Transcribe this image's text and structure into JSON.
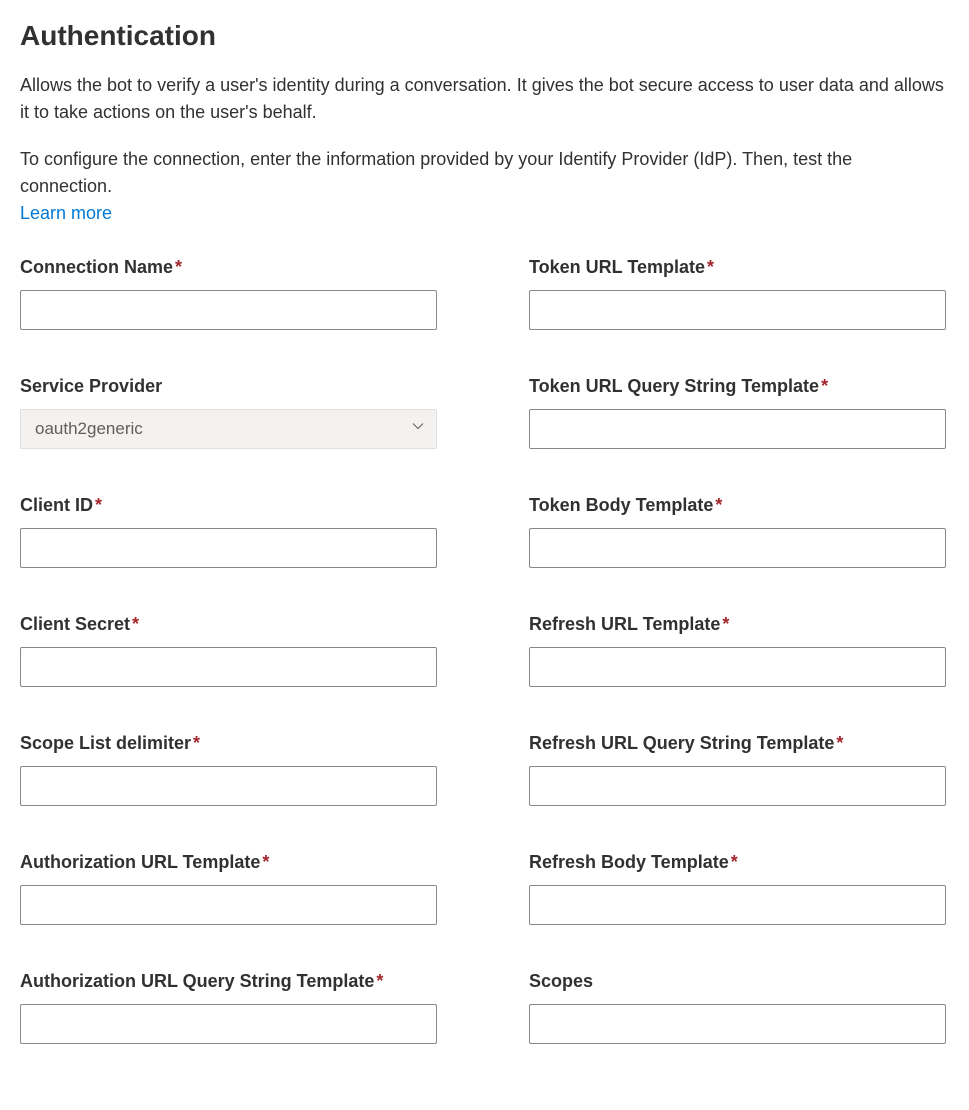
{
  "header": {
    "title": "Authentication",
    "intro1": "Allows the bot to verify a user's identity during a conversation. It gives the bot secure access to user data and allows it to take actions on the user's behalf.",
    "intro2": "To configure the connection, enter the information provided by your Identify Provider (IdP). Then, test the connection. ",
    "learn_more": "Learn more"
  },
  "leftFields": [
    {
      "key": "connection_name",
      "label": "Connection Name",
      "required": true,
      "type": "text",
      "value": ""
    },
    {
      "key": "service_provider",
      "label": "Service Provider",
      "required": false,
      "type": "select",
      "value": "oauth2generic"
    },
    {
      "key": "client_id",
      "label": "Client ID",
      "required": true,
      "type": "text",
      "value": ""
    },
    {
      "key": "client_secret",
      "label": "Client Secret",
      "required": true,
      "type": "text",
      "value": ""
    },
    {
      "key": "scope_list_delimiter",
      "label": "Scope List delimiter",
      "required": true,
      "type": "text",
      "value": ""
    },
    {
      "key": "auth_url_template",
      "label": "Authorization URL Template",
      "required": true,
      "type": "text",
      "value": ""
    },
    {
      "key": "auth_url_query_template",
      "label": "Authorization URL Query String Template",
      "required": true,
      "type": "text",
      "value": ""
    }
  ],
  "rightFields": [
    {
      "key": "token_url_template",
      "label": "Token URL Template",
      "required": true,
      "type": "text",
      "value": ""
    },
    {
      "key": "token_url_query_template",
      "label": "Token URL Query String Template",
      "required": true,
      "type": "text",
      "value": ""
    },
    {
      "key": "token_body_template",
      "label": "Token Body Template",
      "required": true,
      "type": "text",
      "value": ""
    },
    {
      "key": "refresh_url_template",
      "label": "Refresh URL Template",
      "required": true,
      "type": "text",
      "value": ""
    },
    {
      "key": "refresh_url_query_template",
      "label": "Refresh URL Query String Template",
      "required": true,
      "type": "text",
      "value": ""
    },
    {
      "key": "refresh_body_template",
      "label": "Refresh Body Template",
      "required": true,
      "type": "text",
      "value": ""
    },
    {
      "key": "scopes",
      "label": "Scopes",
      "required": false,
      "type": "text",
      "value": ""
    }
  ]
}
